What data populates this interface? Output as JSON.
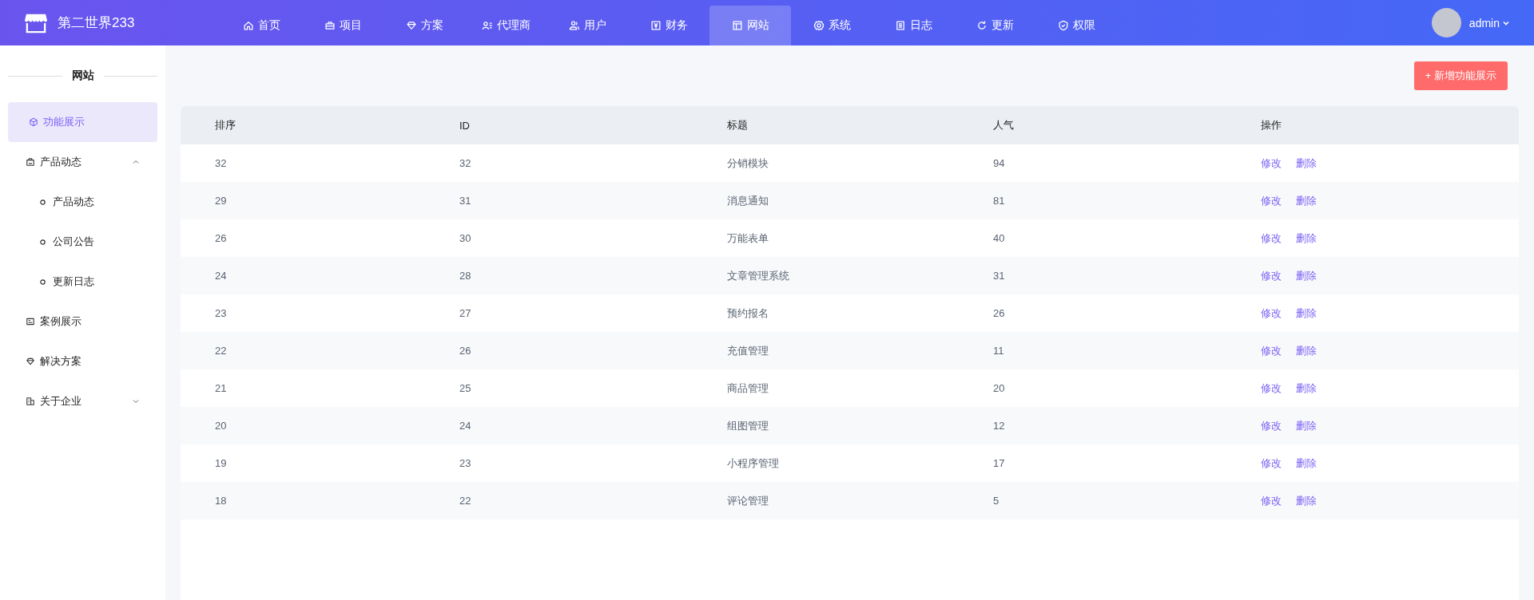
{
  "brand": {
    "name": "第二世界233"
  },
  "nav": [
    {
      "label": "首页",
      "kind": "home",
      "selected": false
    },
    {
      "label": "项目",
      "kind": "briefcase",
      "selected": false
    },
    {
      "label": "方案",
      "kind": "diamond",
      "selected": false
    },
    {
      "label": "代理商",
      "kind": "agent",
      "selected": false
    },
    {
      "label": "用户",
      "kind": "users",
      "selected": false
    },
    {
      "label": "财务",
      "kind": "money",
      "selected": false
    },
    {
      "label": "网站",
      "kind": "layout",
      "selected": true
    },
    {
      "label": "系统",
      "kind": "gear",
      "selected": false
    },
    {
      "label": "日志",
      "kind": "doc",
      "selected": false
    },
    {
      "label": "更新",
      "kind": "refresh",
      "selected": false
    },
    {
      "label": "权限",
      "kind": "shield",
      "selected": false
    }
  ],
  "user": {
    "name": "admin"
  },
  "sidebar": {
    "title": "网站",
    "items": [
      {
        "label": "功能展示",
        "kind": "cube",
        "selected": true
      },
      {
        "label": "产品动态",
        "kind": "bag",
        "selected": false,
        "expanded": true,
        "children": [
          {
            "label": "产品动态",
            "selected": false
          },
          {
            "label": "公司公告",
            "selected": false
          },
          {
            "label": "更新日志",
            "selected": false
          }
        ]
      },
      {
        "label": "案例展示",
        "kind": "card",
        "selected": false
      },
      {
        "label": "解决方案",
        "kind": "diamond",
        "selected": false
      },
      {
        "label": "关于企业",
        "kind": "building",
        "selected": false,
        "expanded": false
      }
    ]
  },
  "add_button": "+ 新增功能展示",
  "table": {
    "columns": [
      "排序",
      "ID",
      "标题",
      "人气",
      "操作"
    ],
    "rows": [
      {
        "cells": [
          "32",
          "32",
          "分销模块",
          "94"
        ],
        "actions": [
          "修改",
          "删除"
        ]
      },
      {
        "cells": [
          "29",
          "31",
          "消息通知",
          "81"
        ],
        "actions": [
          "修改",
          "删除"
        ]
      },
      {
        "cells": [
          "26",
          "30",
          "万能表单",
          "40"
        ],
        "actions": [
          "修改",
          "删除"
        ]
      },
      {
        "cells": [
          "24",
          "28",
          "文章管理系统",
          "31"
        ],
        "actions": [
          "修改",
          "删除"
        ]
      },
      {
        "cells": [
          "23",
          "27",
          "预约报名",
          "26"
        ],
        "actions": [
          "修改",
          "删除"
        ]
      },
      {
        "cells": [
          "22",
          "26",
          "充值管理",
          "11"
        ],
        "actions": [
          "修改",
          "删除"
        ]
      },
      {
        "cells": [
          "21",
          "25",
          "商品管理",
          "20"
        ],
        "actions": [
          "修改",
          "删除"
        ]
      },
      {
        "cells": [
          "20",
          "24",
          "组图管理",
          "12"
        ],
        "actions": [
          "修改",
          "删除"
        ]
      },
      {
        "cells": [
          "19",
          "23",
          "小程序管理",
          "17"
        ],
        "actions": [
          "修改",
          "删除"
        ]
      },
      {
        "cells": [
          "18",
          "22",
          "评论管理",
          "5"
        ],
        "actions": [
          "修改",
          "删除"
        ]
      }
    ]
  }
}
